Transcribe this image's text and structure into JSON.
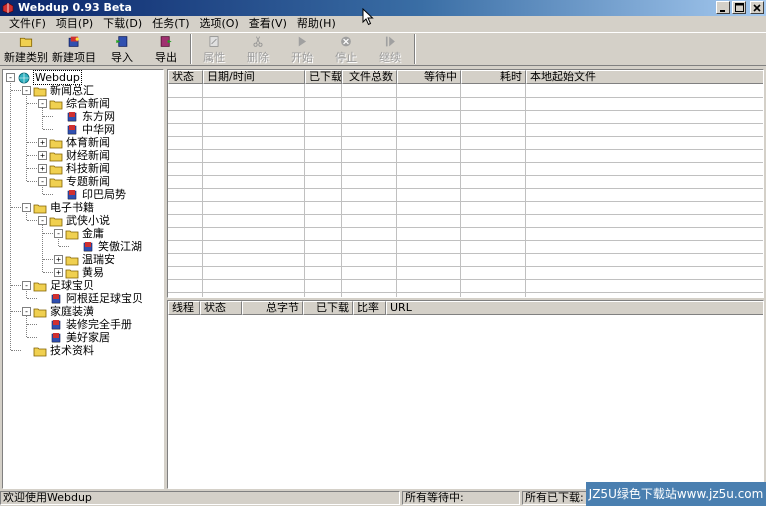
{
  "window": {
    "title": "Webdup 0.93 Beta"
  },
  "menu": [
    "文件(F)",
    "项目(P)",
    "下载(D)",
    "任务(T)",
    "选项(O)",
    "查看(V)",
    "帮助(H)"
  ],
  "toolbar": [
    {
      "label": "新建类别",
      "icon": "folder-icon",
      "enabled": true
    },
    {
      "label": "新建项目",
      "icon": "new-project-icon",
      "enabled": true
    },
    {
      "label": "导入",
      "icon": "import-icon",
      "enabled": true
    },
    {
      "label": "导出",
      "icon": "export-icon",
      "enabled": true
    },
    {
      "label": "属性",
      "icon": "properties-icon",
      "enabled": false
    },
    {
      "label": "删除",
      "icon": "scissors-icon",
      "enabled": false
    },
    {
      "label": "开始",
      "icon": "play-icon",
      "enabled": false
    },
    {
      "label": "停止",
      "icon": "stop-icon",
      "enabled": false
    },
    {
      "label": "继续",
      "icon": "resume-icon",
      "enabled": false
    }
  ],
  "tree": [
    {
      "label": "Webdup",
      "level": 0,
      "icon": "globe-icon",
      "expander": "-",
      "selected": true
    },
    {
      "label": "新闻总汇",
      "level": 1,
      "icon": "folder-icon",
      "expander": "-"
    },
    {
      "label": "综合新闻",
      "level": 2,
      "icon": "folder-icon",
      "expander": "-"
    },
    {
      "label": "东方网",
      "level": 3,
      "icon": "book-icon",
      "expander": ""
    },
    {
      "label": "中华网",
      "level": 3,
      "icon": "book-icon",
      "expander": ""
    },
    {
      "label": "体育新闻",
      "level": 2,
      "icon": "folder-icon",
      "expander": "+"
    },
    {
      "label": "财经新闻",
      "level": 2,
      "icon": "folder-icon",
      "expander": "+"
    },
    {
      "label": "科技新闻",
      "level": 2,
      "icon": "folder-icon",
      "expander": "+"
    },
    {
      "label": "专题新闻",
      "level": 2,
      "icon": "folder-icon",
      "expander": "-"
    },
    {
      "label": "印巴局势",
      "level": 3,
      "icon": "book-icon",
      "expander": ""
    },
    {
      "label": "电子书籍",
      "level": 1,
      "icon": "folder-icon",
      "expander": "-"
    },
    {
      "label": "武侠小说",
      "level": 2,
      "icon": "folder-icon",
      "expander": "-"
    },
    {
      "label": "金庸",
      "level": 3,
      "icon": "folder-icon",
      "expander": "-"
    },
    {
      "label": "笑傲江湖",
      "level": 4,
      "icon": "book-icon",
      "expander": ""
    },
    {
      "label": "温瑞安",
      "level": 3,
      "icon": "folder-icon",
      "expander": "+"
    },
    {
      "label": "黄易",
      "level": 3,
      "icon": "folder-icon",
      "expander": "+"
    },
    {
      "label": "足球宝贝",
      "level": 1,
      "icon": "folder-icon",
      "expander": "-"
    },
    {
      "label": "阿根廷足球宝贝",
      "level": 2,
      "icon": "book-icon",
      "expander": ""
    },
    {
      "label": "家庭装潢",
      "level": 1,
      "icon": "folder-icon",
      "expander": "-"
    },
    {
      "label": "装修完全手册",
      "level": 2,
      "icon": "book-icon",
      "expander": ""
    },
    {
      "label": "美好家居",
      "level": 2,
      "icon": "book-icon",
      "expander": ""
    },
    {
      "label": "技术资料",
      "level": 1,
      "icon": "folder-icon",
      "expander": ""
    }
  ],
  "top_list": {
    "columns": [
      {
        "label": "状态",
        "align": "left"
      },
      {
        "label": "日期/时间",
        "align": "left"
      },
      {
        "label": "已下载",
        "align": "right"
      },
      {
        "label": "文件总数",
        "align": "right"
      },
      {
        "label": "等待中",
        "align": "right"
      },
      {
        "label": "耗时",
        "align": "right"
      },
      {
        "label": "本地起始文件",
        "align": "left"
      }
    ]
  },
  "bottom_list": {
    "columns": [
      {
        "label": "线程",
        "align": "left"
      },
      {
        "label": "状态",
        "align": "left"
      },
      {
        "label": "总字节",
        "align": "right"
      },
      {
        "label": "已下载",
        "align": "right"
      },
      {
        "label": "比率",
        "align": "left"
      },
      {
        "label": "URL",
        "align": "left"
      }
    ]
  },
  "status": {
    "message": "欢迎使用Webdup",
    "waiting_label": "所有等待中:",
    "downloaded_label": "所有已下载:"
  },
  "watermark": "JZ5U绿色下载站www.jz5u.com"
}
